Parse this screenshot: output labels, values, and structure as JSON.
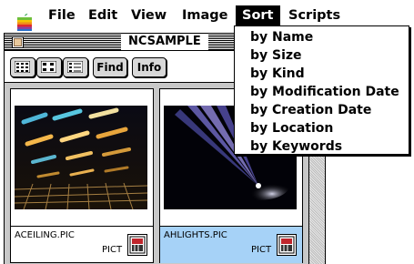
{
  "menubar": {
    "items": [
      "File",
      "Edit",
      "View",
      "Image",
      "Sort",
      "Scripts"
    ],
    "active": "Sort"
  },
  "window": {
    "title": "NCSAMPLE",
    "toolbar": {
      "find_label": "Find",
      "info_label": "Info"
    }
  },
  "files": [
    {
      "name": "ACEILING.PIC",
      "type": "PICT",
      "selected": false
    },
    {
      "name": "AHLIGHTS.PIC",
      "type": "PICT",
      "selected": true
    }
  ],
  "sort_menu": {
    "items": [
      "by Name",
      "by Size",
      "by Kind",
      "by Modification Date",
      "by Creation Date",
      "by Location",
      "by Keywords"
    ]
  },
  "colors": {
    "selection_label": "#a6d2f7",
    "content_background": "#c8c8c8"
  }
}
